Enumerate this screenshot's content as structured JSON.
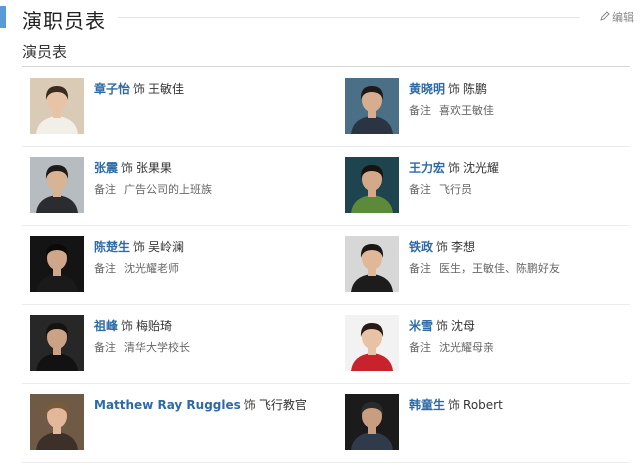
{
  "header": {
    "title": "演职员表",
    "edit_label": "编辑"
  },
  "section": {
    "subtitle": "演员表"
  },
  "cast": [
    {
      "actor": "章子怡",
      "separator": "饰",
      "role": "王敏佳",
      "note_label": "",
      "note": "",
      "colors": {
        "bg": "#d9cbb6",
        "hair": "#3b2a20",
        "face": "#e8c4a6",
        "body": "#f2efe9"
      }
    },
    {
      "actor": "黄晓明",
      "separator": "饰",
      "role": "陈鹏",
      "note_label": "备注",
      "note": "喜欢王敏佳",
      "colors": {
        "bg": "#4a6f86",
        "hair": "#1d1a18",
        "face": "#d6ad8e",
        "body": "#2b3442"
      }
    },
    {
      "actor": "张震",
      "separator": "饰",
      "role": "张果果",
      "note_label": "备注",
      "note": "广告公司的上班族",
      "colors": {
        "bg": "#b6bcc0",
        "hair": "#1f1b18",
        "face": "#d9b494",
        "body": "#2a2c30"
      }
    },
    {
      "actor": "王力宏",
      "separator": "饰",
      "role": "沈光耀",
      "note_label": "备注",
      "note": "飞行员",
      "colors": {
        "bg": "#1e4450",
        "hair": "#17130f",
        "face": "#d3a98a",
        "body": "#5a8a3a"
      }
    },
    {
      "actor": "陈楚生",
      "separator": "饰",
      "role": "吴岭澜",
      "note_label": "备注",
      "note": "沈光耀老师",
      "colors": {
        "bg": "#141414",
        "hair": "#0c0a09",
        "face": "#cfa689",
        "body": "#1a1a1a"
      }
    },
    {
      "actor": "铁政",
      "separator": "饰",
      "role": "李想",
      "note_label": "备注",
      "note": "医生，王敏佳、陈鹏好友",
      "colors": {
        "bg": "#d7d7d7",
        "hair": "#1a1714",
        "face": "#e0b898",
        "body": "#1c1c1c"
      }
    },
    {
      "actor": "祖峰",
      "separator": "饰",
      "role": "梅贻琦",
      "note_label": "备注",
      "note": "清华大学校长",
      "colors": {
        "bg": "#272727",
        "hair": "#15120f",
        "face": "#cba285",
        "body": "#121212"
      }
    },
    {
      "actor": "米雪",
      "separator": "饰",
      "role": "沈母",
      "note_label": "备注",
      "note": "沈光耀母亲",
      "colors": {
        "bg": "#f2f2f2",
        "hair": "#2a1a14",
        "face": "#e8c2a4",
        "body": "#c8222c"
      }
    },
    {
      "actor": "Matthew Ray Ruggles",
      "separator": "饰",
      "role": "飞行教官",
      "note_label": "",
      "note": "",
      "colors": {
        "bg": "#6e5a45",
        "hair": "#7a5a38",
        "face": "#e2b79a",
        "body": "#3c3028"
      }
    },
    {
      "actor": "韩童生",
      "separator": "饰",
      "role": "Robert",
      "note_label": "",
      "note": "",
      "colors": {
        "bg": "#1b1b1b",
        "hair": "#2b2b2b",
        "face": "#c89e80",
        "body": "#2f3a4a"
      }
    }
  ]
}
